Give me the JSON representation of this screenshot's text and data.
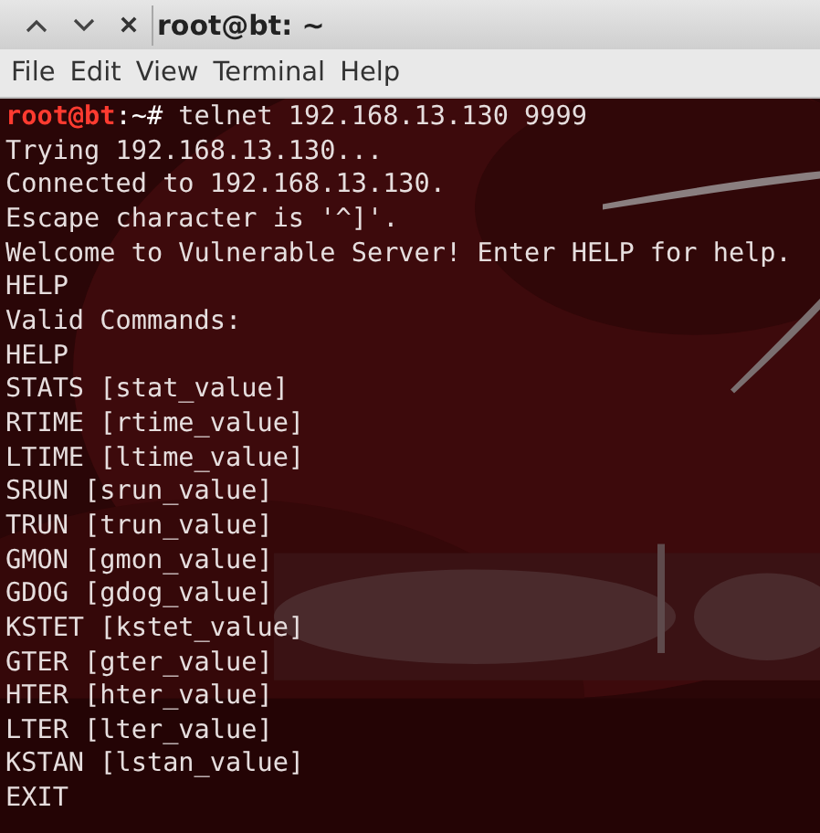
{
  "window": {
    "title": "root@bt: ~"
  },
  "menu": [
    "File",
    "Edit",
    "View",
    "Terminal",
    "Help"
  ],
  "terminal": {
    "lines": [
      {
        "kind": "prompt",
        "user": "root@bt",
        "rest": ":~#",
        "text": "telnet 192.168.13.130 9999"
      },
      {
        "kind": "output",
        "text": "Trying 192.168.13.130..."
      },
      {
        "kind": "output",
        "text": "Connected to 192.168.13.130."
      },
      {
        "kind": "output",
        "text": "Escape character is '^]'."
      },
      {
        "kind": "output",
        "text": "Welcome to Vulnerable Server! Enter HELP for help."
      },
      {
        "kind": "output",
        "text": "HELP"
      },
      {
        "kind": "output",
        "text": "Valid Commands:"
      },
      {
        "kind": "output",
        "text": "HELP"
      },
      {
        "kind": "output",
        "text": "STATS [stat_value]"
      },
      {
        "kind": "output",
        "text": "RTIME [rtime_value]"
      },
      {
        "kind": "output",
        "text": "LTIME [ltime_value]"
      },
      {
        "kind": "output",
        "text": "SRUN [srun_value]"
      },
      {
        "kind": "output",
        "text": "TRUN [trun_value]"
      },
      {
        "kind": "output",
        "text": "GMON [gmon_value]"
      },
      {
        "kind": "output",
        "text": "GDOG [gdog_value]"
      },
      {
        "kind": "output",
        "text": "KSTET [kstet_value]"
      },
      {
        "kind": "output",
        "text": "GTER [gter_value]"
      },
      {
        "kind": "output",
        "text": "HTER [hter_value]"
      },
      {
        "kind": "output",
        "text": "LTER [lter_value]"
      },
      {
        "kind": "output",
        "text": "KSTAN [lstan_value]"
      },
      {
        "kind": "output",
        "text": "EXIT"
      }
    ]
  }
}
